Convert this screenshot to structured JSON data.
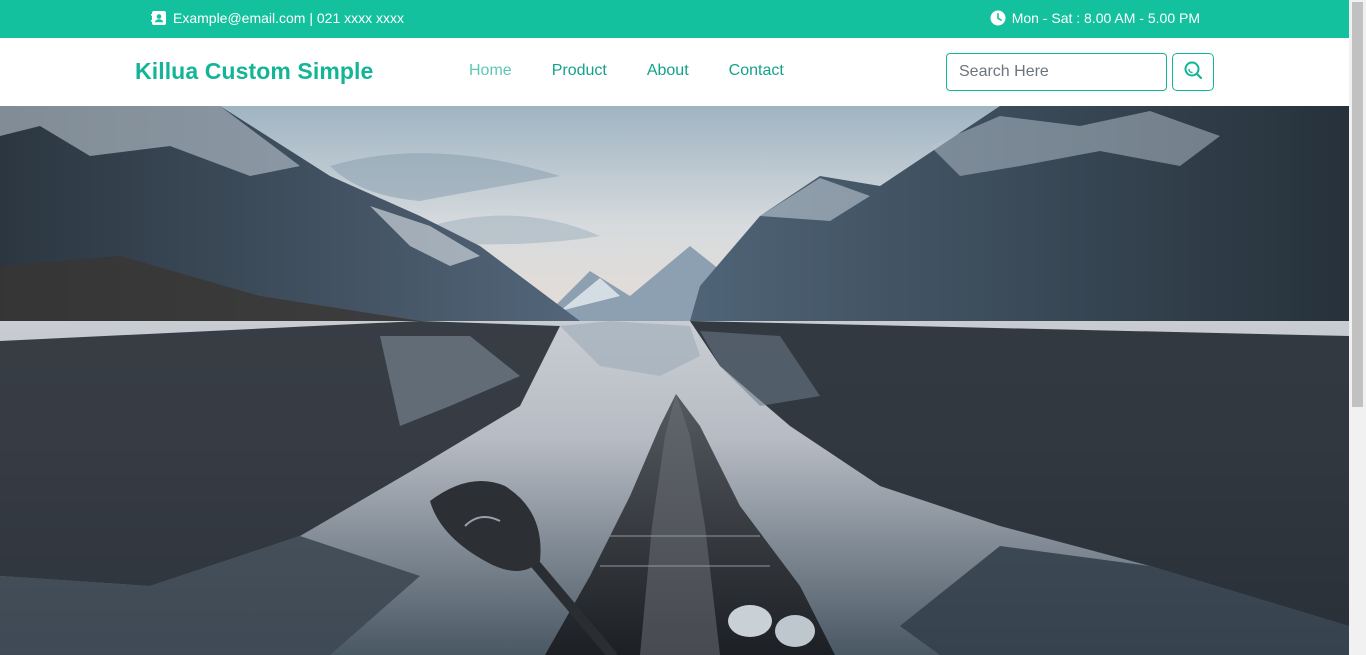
{
  "topbar": {
    "contact_text": "Example@email.com | 021 xxxx xxxx",
    "contact_icon": "contact-card-icon",
    "hours_text": "Mon - Sat : 8.00 AM - 5.00 PM",
    "hours_icon": "clock-icon",
    "background_color": "#14c19f"
  },
  "navbar": {
    "brand": "Killua Custom Simple",
    "links": [
      {
        "label": "Home",
        "active": true
      },
      {
        "label": "Product",
        "active": false
      },
      {
        "label": "About",
        "active": false
      },
      {
        "label": "Contact",
        "active": false
      }
    ],
    "search": {
      "placeholder": "Search Here",
      "value": "",
      "button_icon": "search-icon"
    },
    "accent_color": "#14b596"
  },
  "hero": {
    "image_description": "kayak-on-fjord-lake-with-mountains"
  }
}
